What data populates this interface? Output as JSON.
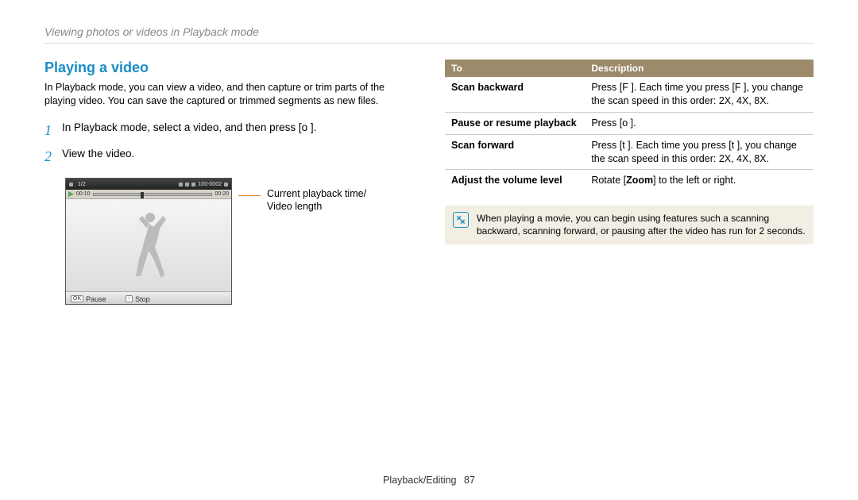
{
  "breadcrumb": "Viewing photos or videos in Playback mode",
  "section_title": "Playing a video",
  "intro": "In Playback mode, you can view a video, and then capture or trim parts of the playing video. You can save the captured or trimmed segments as new files.",
  "steps": [
    "In Playback mode, select a video, and then press [o   ].",
    "View the video."
  ],
  "screenshot": {
    "counter": "1/2",
    "file_label": "100-0002",
    "time_current": "00:10",
    "time_total": "00:20",
    "footer_pause": "Pause",
    "footer_pause_key": "OK",
    "footer_stop": "Stop",
    "footer_stop_key": "↑"
  },
  "callout": "Current playback time/\nVideo length",
  "table": {
    "head_to": "To",
    "head_desc": "Description",
    "rows": [
      {
        "to": "Scan backward",
        "desc": "Press [F   ]. Each time you press [F   ], you change the scan speed in this order: 2X, 4X, 8X."
      },
      {
        "to": "Pause or resume playback",
        "desc": "Press [o   ]."
      },
      {
        "to": "Scan forward",
        "desc": "Press [t   ]. Each time you press [t   ], you change the scan speed in this order: 2X, 4X, 8X."
      },
      {
        "to": "Adjust the volume level",
        "desc_pre": "Rotate [",
        "desc_bold": "Zoom",
        "desc_post": "] to the left or right."
      }
    ]
  },
  "note": "When playing a movie, you can begin using features such a scanning backward, scanning forward, or pausing after the video has run for 2 seconds.",
  "footer_section": "Playback/Editing",
  "footer_page": "87"
}
